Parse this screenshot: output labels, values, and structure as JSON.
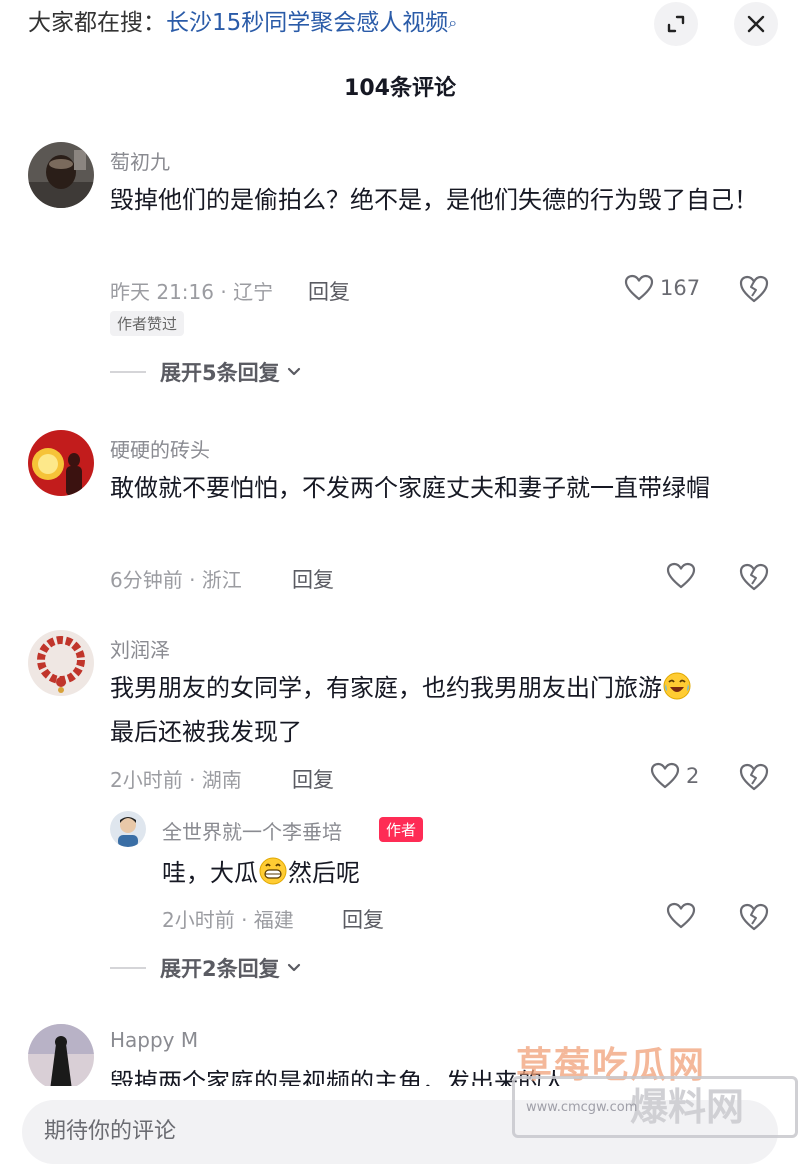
{
  "header": {
    "search_prefix": "大家都在搜：",
    "search_query": "长沙15秒同学聚会感人视频",
    "comment_count_title": "104条评论"
  },
  "comments": [
    {
      "username": "萄初九",
      "content": "毁掉他们的是偷拍么？绝不是，是他们失德的行为毁了自己！",
      "meta": "昨天 21:16 · 辽宁",
      "reply_label": "回复",
      "likes": "167",
      "badge": "作者赞过",
      "expand_label": "展开5条回复"
    },
    {
      "username": "硬硬的砖头",
      "content": "敢做就不要怕怕，不发两个家庭丈夫和妻子就一直带绿帽",
      "meta": "6分钟前 · 浙江",
      "reply_label": "回复",
      "likes": ""
    },
    {
      "username": "刘润泽",
      "content": "我男朋友的女同学，有家庭，也约我男朋友出门旅游",
      "content_line2": "最后还被我发现了",
      "meta": "2小时前 · 湖南",
      "reply_label": "回复",
      "likes": "2",
      "reply": {
        "username": "全世界就一个李垂培",
        "author_tag": "作者",
        "content_a": "哇，大瓜",
        "content_b": "然后呢",
        "meta": "2小时前 · 福建",
        "reply_label": "回复",
        "likes": ""
      },
      "expand_label": "展开2条回复"
    },
    {
      "username": "Happy M",
      "content": "毁掉两个家庭的是视频的主角，发出来的人..."
    }
  ],
  "input": {
    "placeholder": "期待你的评论"
  },
  "watermark": {
    "top_text": "草莓吃瓜网",
    "main_text": "爆料网",
    "url": "www.cmcgw.com"
  },
  "colors": {
    "query_link": "#2a5ba8",
    "author_tag_bg": "#fe2c55",
    "muted_text": "#9b9ca1"
  },
  "icons": [
    "search-icon",
    "expand-icon",
    "close-icon",
    "heart-icon",
    "broken-heart-icon",
    "chevron-down-icon"
  ]
}
